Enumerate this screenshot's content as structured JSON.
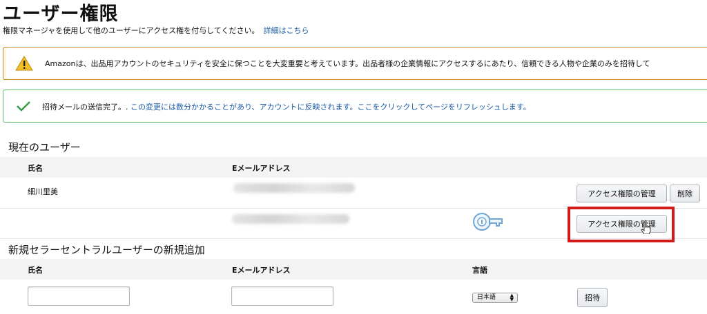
{
  "page": {
    "title": "ユーザー権限",
    "subtitle": "権限マネージャを使用して他のユーザーにアクセス権を付与してください。",
    "details_link": "詳細はこちら"
  },
  "alerts": {
    "warning_text": "Amazonは、出品用アカウントのセキュリティを安全に保つことを大変重要と考えています。出品者様の企業情報にアクセスするにあたり、信頼できる人物や企業のみを招待して",
    "success_text": "招待メールの送信完了。.",
    "success_link": "この変更には数分かかることがあり、アカウントに反映されます。ここをクリックしてページをリフレッシュします。",
    "colors": {
      "warning_border": "#c98e2b",
      "warning_icon": "#f0c02b",
      "success_border": "#5fb86a",
      "success_icon": "#3a9a44"
    }
  },
  "current_users": {
    "section_title": "現在のユーザー",
    "col_name": "氏名",
    "col_email": "Eメールアドレス",
    "rows": [
      {
        "name": "細川里美",
        "manage_button": "アクセス権限の管理",
        "delete_button": "削除"
      },
      {
        "name": "",
        "manage_button": "アクセス権限の管理"
      }
    ]
  },
  "new_user": {
    "section_title": "新規セラーセントラルユーザーの新規追加",
    "col_name": "氏名",
    "col_email": "Eメールアドレス",
    "col_language": "言語",
    "name_value": "",
    "email_value": "",
    "language_selected": "日本語",
    "invite_button": "招待"
  },
  "icons": [
    "warning-icon",
    "checkmark-icon",
    "key-icon",
    "hand-pointer-icon"
  ],
  "accent": {
    "link": "#1a5aa6",
    "highlight": "#d21a1a"
  }
}
